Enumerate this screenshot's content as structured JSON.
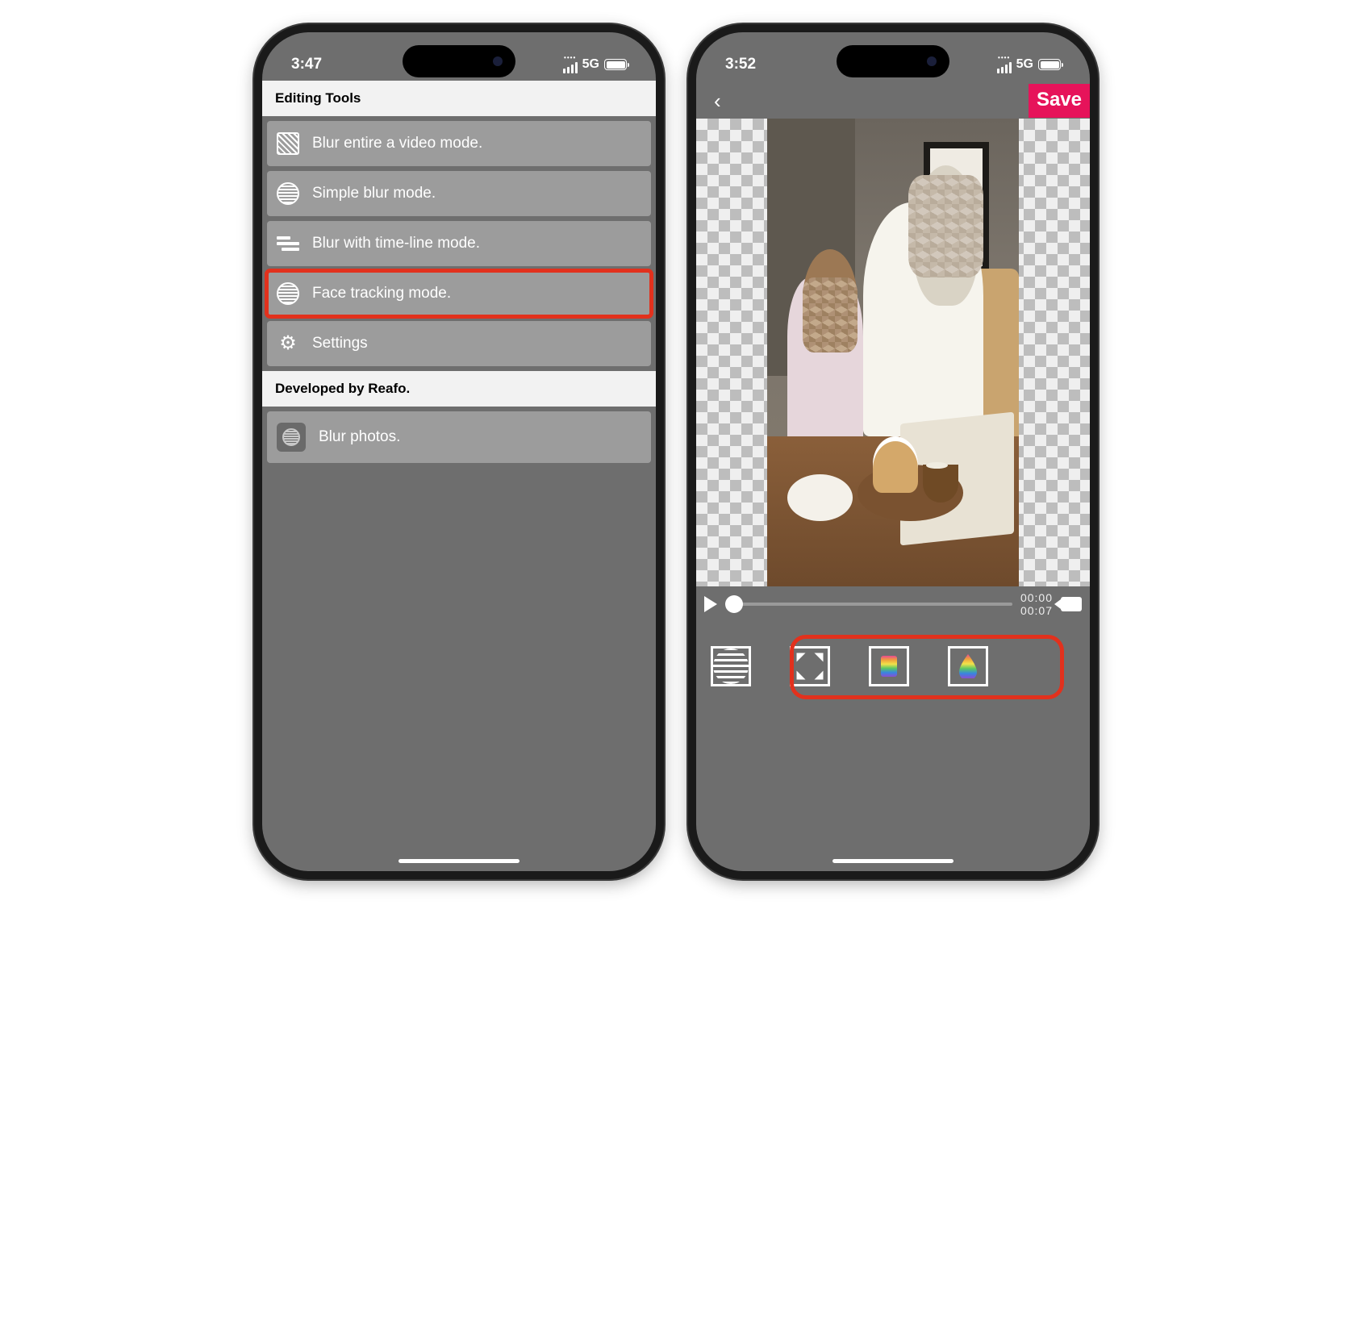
{
  "left": {
    "status": {
      "time": "3:47",
      "network": "5G"
    },
    "sections": [
      {
        "title": "Editing Tools",
        "items": [
          {
            "key": "blur-entire",
            "label": "Blur entire a video mode.",
            "icon": "hatch-square"
          },
          {
            "key": "simple-blur",
            "label": "Simple blur mode.",
            "icon": "stripe-circle"
          },
          {
            "key": "timeline-blur",
            "label": "Blur with time-line mode.",
            "icon": "bars"
          },
          {
            "key": "face-track",
            "label": "Face tracking mode.",
            "icon": "stripe-circle",
            "highlight": true
          },
          {
            "key": "settings",
            "label": "Settings",
            "icon": "gear"
          }
        ]
      },
      {
        "title": "Developed by Reafo.",
        "items": [
          {
            "key": "blur-photos",
            "label": "Blur photos.",
            "icon": "photo-app"
          }
        ]
      }
    ]
  },
  "right": {
    "status": {
      "time": "3:52",
      "network": "5G"
    },
    "header": {
      "save_label": "Save"
    },
    "player": {
      "current": "00:00",
      "total": "00:07"
    },
    "toolbar": {
      "buttons": [
        {
          "key": "stripes",
          "icon": "stripe-square"
        },
        {
          "key": "expand",
          "icon": "expand"
        },
        {
          "key": "rainbow-square",
          "icon": "rainbow-square"
        },
        {
          "key": "rainbow-drop",
          "icon": "rainbow-drop"
        }
      ]
    }
  }
}
